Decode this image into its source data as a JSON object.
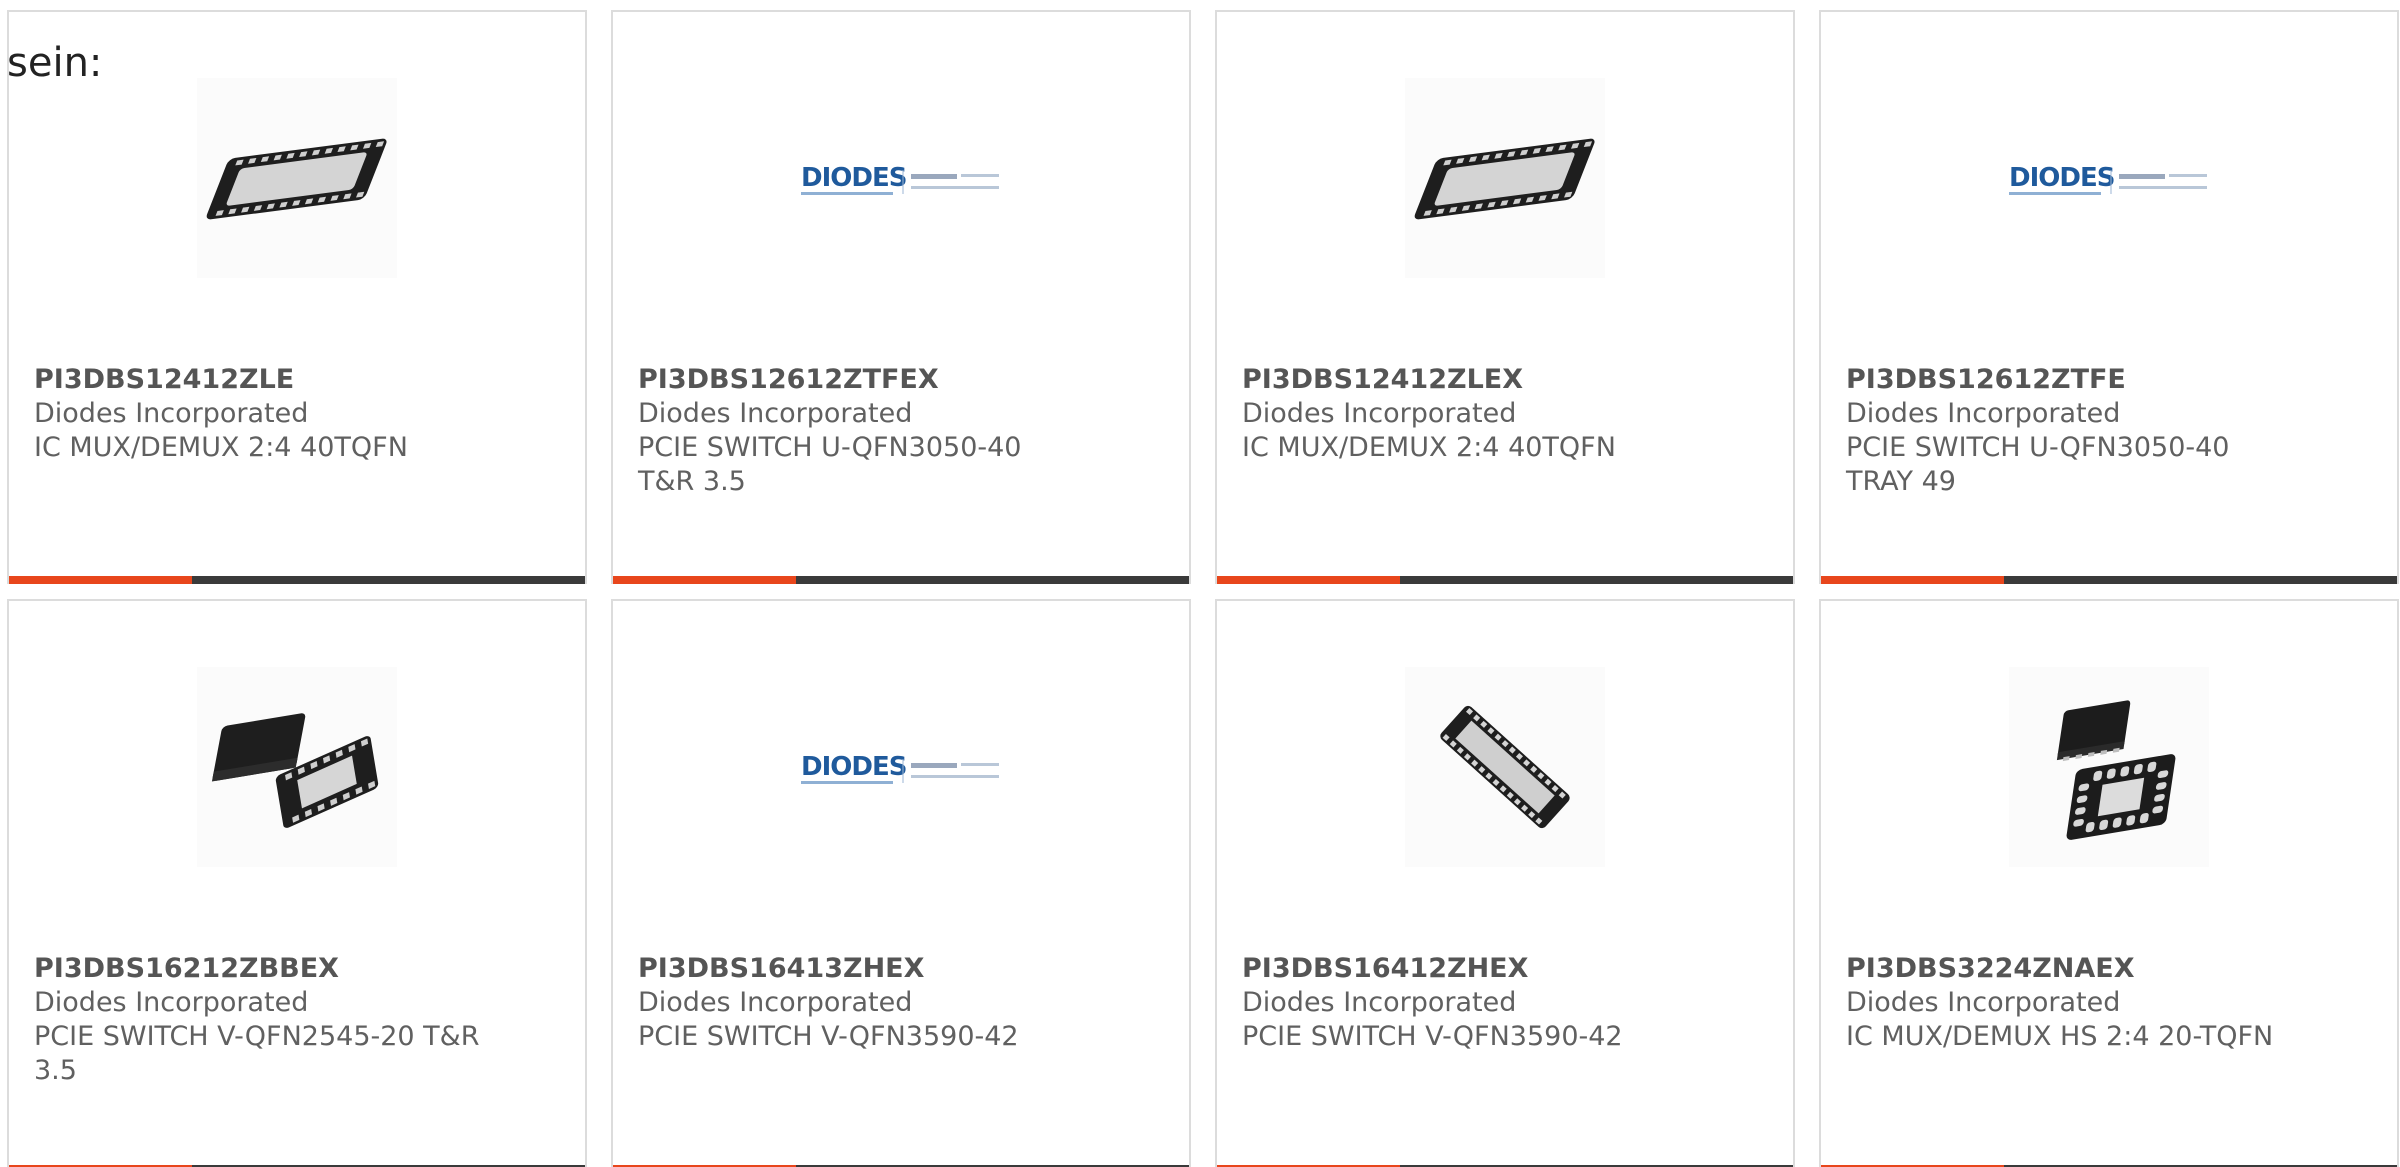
{
  "page": {
    "lead_text": "sein:"
  },
  "products": [
    {
      "part_number": "PI3DBS12412ZLE",
      "manufacturer": "Diodes Incorporated",
      "description_lines": [
        "IC MUX/DEMUX 2:4 40TQFN"
      ],
      "image": "qfn-chip-wide",
      "brand_text": "",
      "accent_color": "#e8461c"
    },
    {
      "part_number": "PI3DBS12612ZTFEX",
      "manufacturer": "Diodes Incorporated",
      "description_lines": [
        "PCIE SWITCH U-QFN3050-40",
        "T&R 3.5"
      ],
      "image": "diodes-pericom-logo",
      "brand_text": "DIODES",
      "accent_color": "#e8461c"
    },
    {
      "part_number": "PI3DBS12412ZLEX",
      "manufacturer": "Diodes Incorporated",
      "description_lines": [
        "IC MUX/DEMUX 2:4 40TQFN"
      ],
      "image": "qfn-chip-wide",
      "brand_text": "",
      "accent_color": "#e8461c"
    },
    {
      "part_number": "PI3DBS12612ZTFE",
      "manufacturer": "Diodes Incorporated",
      "description_lines": [
        "PCIE SWITCH U-QFN3050-40",
        "TRAY 49"
      ],
      "image": "diodes-pericom-logo",
      "brand_text": "DIODES",
      "accent_color": "#e8461c"
    },
    {
      "part_number": "PI3DBS16212ZBBEX",
      "manufacturer": "Diodes Incorporated",
      "description_lines": [
        "PCIE SWITCH V-QFN2545-20 T&R",
        "3.5"
      ],
      "image": "qfn-chip-pair",
      "brand_text": "",
      "accent_color": "#e8461c"
    },
    {
      "part_number": "PI3DBS16413ZHEX",
      "manufacturer": "Diodes Incorporated",
      "description_lines": [
        "PCIE SWITCH V-QFN3590-42"
      ],
      "image": "diodes-pericom-logo",
      "brand_text": "DIODES",
      "accent_color": "#e8461c"
    },
    {
      "part_number": "PI3DBS16412ZHEX",
      "manufacturer": "Diodes Incorporated",
      "description_lines": [
        "PCIE SWITCH V-QFN3590-42"
      ],
      "image": "qfn-chip-diagonal",
      "brand_text": "",
      "accent_color": "#e8461c"
    },
    {
      "part_number": "PI3DBS3224ZNAEX",
      "manufacturer": "Diodes Incorporated",
      "description_lines": [
        "IC MUX/DEMUX HS 2:4 20-TQFN"
      ],
      "image": "qfn-chip-pair-square",
      "brand_text": "",
      "accent_color": "#e8461c"
    }
  ]
}
